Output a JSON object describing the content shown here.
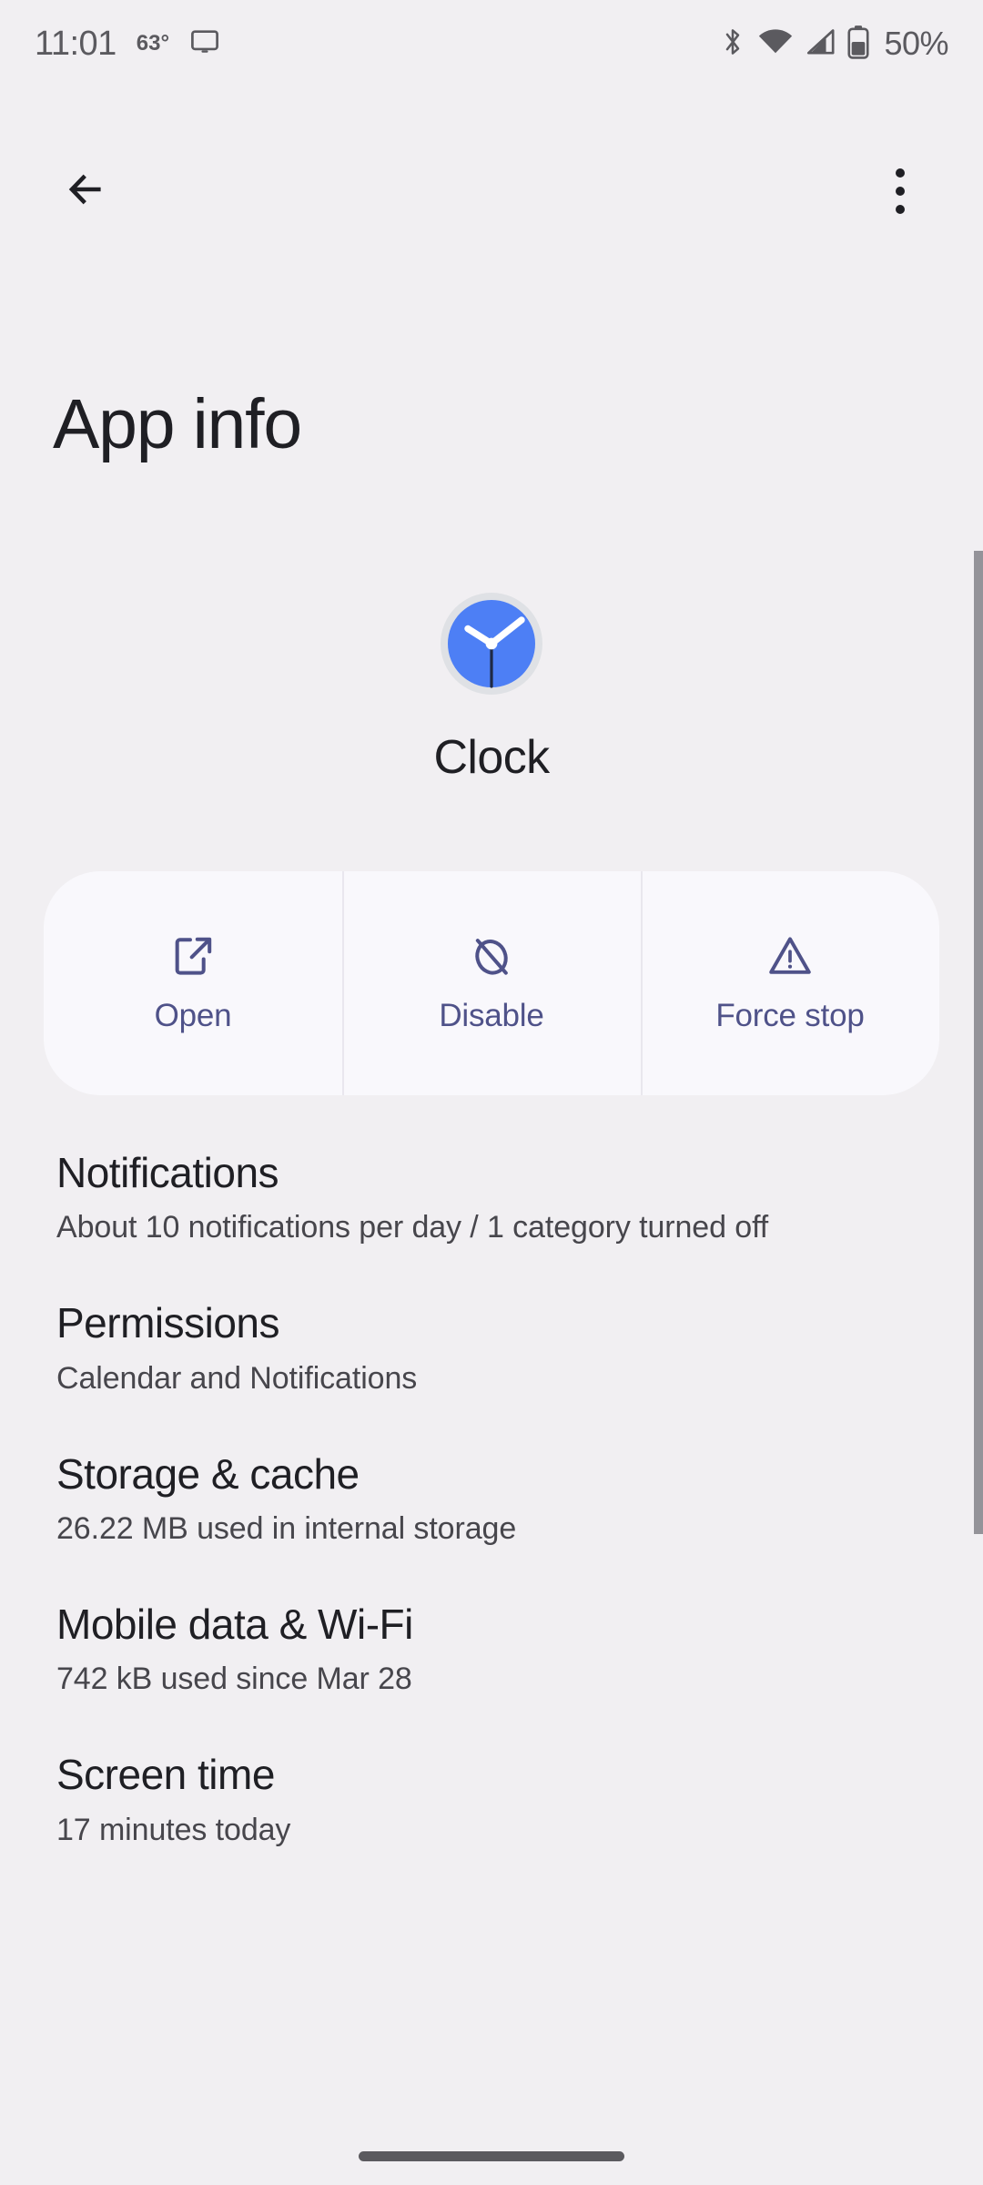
{
  "status_bar": {
    "time": "11:01",
    "temperature": "63°",
    "cast_icon": "monitor-icon",
    "bluetooth_icon": "bluetooth-icon",
    "wifi_icon": "wifi-icon",
    "signal_icon": "cellular-signal-icon",
    "battery_icon": "battery-half-icon",
    "battery_percent": "50%"
  },
  "toolbar": {
    "back_icon": "back-arrow-icon",
    "overflow_icon": "more-vert-icon"
  },
  "header": {
    "title": "App info"
  },
  "app": {
    "name": "Clock",
    "icon": "clock-app-icon"
  },
  "actions": [
    {
      "label": "Open",
      "icon": "open-in-new-icon"
    },
    {
      "label": "Disable",
      "icon": "block-circle-slash-icon"
    },
    {
      "label": "Force stop",
      "icon": "warning-triangle-icon"
    }
  ],
  "settings": [
    {
      "title": "Notifications",
      "subtitle": "About 10 notifications per day / 1 category turned off"
    },
    {
      "title": "Permissions",
      "subtitle": "Calendar and Notifications"
    },
    {
      "title": "Storage & cache",
      "subtitle": "26.22 MB used in internal storage"
    },
    {
      "title": "Mobile data & Wi-Fi",
      "subtitle": "742 kB used since Mar 28"
    },
    {
      "title": "Screen time",
      "subtitle": "17 minutes today"
    }
  ],
  "colors": {
    "page_background": "#f1eff2",
    "card_background": "#f9f8fc",
    "accent_action": "#4f5289",
    "text_primary": "#1f1f24",
    "text_secondary": "#47464c",
    "status_icon": "#5b5a5f",
    "clock_blue": "#4d7ff5",
    "clock_ring": "#dfe1e5",
    "scrollbar": "#949399"
  },
  "scrollbar": {
    "name": "vertical-scrollbar"
  },
  "gesture_bar": {
    "name": "home-gesture-bar"
  }
}
